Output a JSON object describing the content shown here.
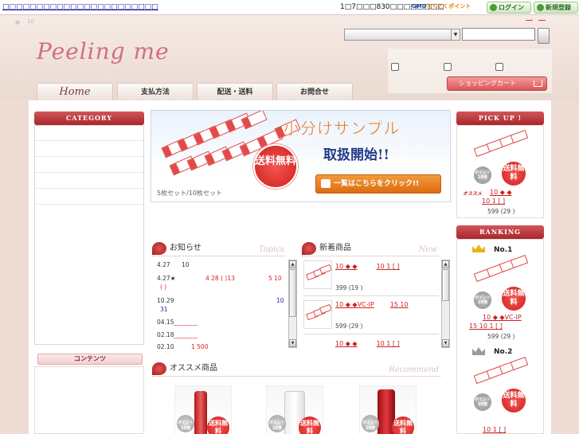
{
  "topbar": {
    "link_text": "□□□□□□□□□□□□□□□□□□□□□□□",
    "point_text": "1□7□□□830□□□□□□□□",
    "gmo_logo": {
      "brand": "GMO",
      "text": "とくとくポイント"
    },
    "login_label": "ログイン",
    "register_label": "新規登録"
  },
  "header": {
    "bullet": "●",
    "small_text": "10",
    "logo_text": "Peeling me",
    "category_select": "",
    "search_placeholder": "",
    "cart_label": "ショッピングカート"
  },
  "nav": {
    "home": "Home",
    "payment": "支払方法",
    "shipping": "配送・送料",
    "contact": "お問合せ"
  },
  "sidebar": {
    "category_title": "CATEGORY",
    "contents_title": "コンテンツ"
  },
  "banner": {
    "title": "小分けサンプル",
    "subtitle": "取扱開始!!",
    "badge": "送料無料",
    "button": "一覧はこちらをクリック!!",
    "caption": "5枚セット/10枚セット"
  },
  "news": {
    "title": "お知らせ",
    "title_en": "Topics",
    "items": [
      {
        "date": "4.27",
        "text": "10"
      },
      {
        "date": "4.27★",
        "text": "4 28 ( )13",
        "text2": "5 10",
        "text3": "( )"
      },
      {
        "date": "10.29",
        "text": "10",
        "text2": "31"
      },
      {
        "date": "04.15",
        "text": "________"
      },
      {
        "date": "02.18",
        "text": "________"
      },
      {
        "date": "02.10",
        "text": "1 500"
      }
    ]
  },
  "new_items": {
    "title": "新着商品",
    "title_en": "New",
    "items": [
      {
        "name": "10 ◆ ◆",
        "name2": "10 1 [ ]",
        "price": "399 (19 )"
      },
      {
        "name": "10 ◆ ◆VC-IP",
        "name2": "15 10",
        "price": "599 (29 )"
      },
      {
        "name": "10 ◆ ◆",
        "name2": "10 1 [ ]",
        "price": ""
      }
    ]
  },
  "recommend": {
    "title": "オススメ商品",
    "title_en": "Recommend",
    "badge": "送料無料",
    "point_badge": "ポイント10倍"
  },
  "pickup": {
    "title": "PICK UP !",
    "badge": "送料無料",
    "point_badge": "ポイント10倍",
    "osusume": "オススメ",
    "name": "10 ◆ ◆",
    "name2": "10 1 [ ]",
    "price": "599 (29 )"
  },
  "ranking": {
    "title": "RANKING",
    "badge": "送料無料",
    "point_badge": "ポイント10倍",
    "items": [
      {
        "rank": "No.1",
        "name": "10 ◆ ◆VC-IP",
        "name2": "15 10 1 [ ]",
        "price": "599 (29 )"
      },
      {
        "rank": "No.2",
        "name": "10 1 [ ]",
        "price": ""
      }
    ]
  },
  "colors": {
    "accent": "#c0393d",
    "link_red": "#cc2222",
    "background": "#ecdcd4"
  }
}
